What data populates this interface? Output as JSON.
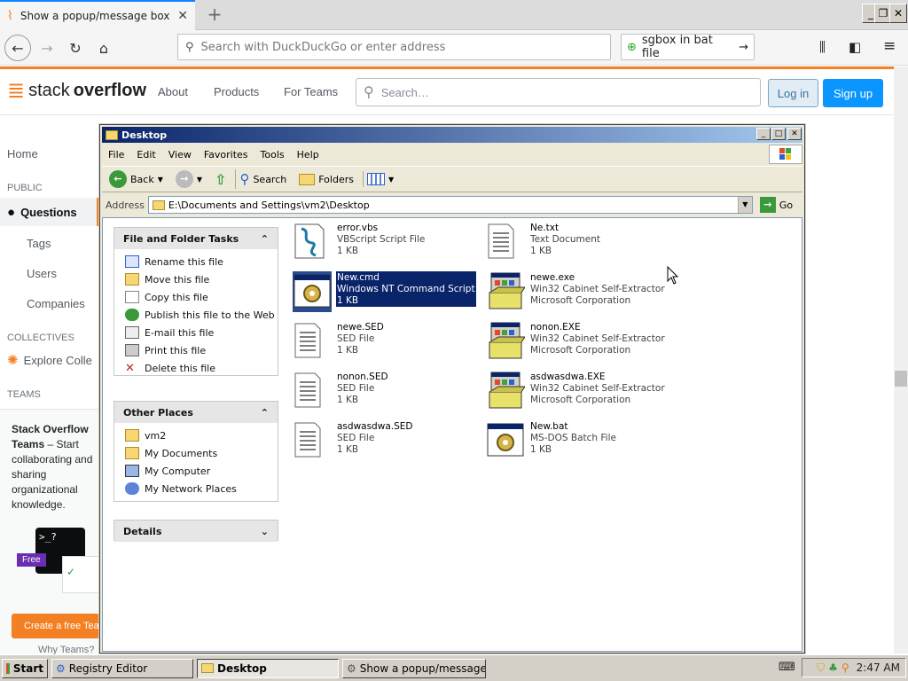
{
  "browser": {
    "tab_title": "Show a popup/message box from",
    "url_placeholder": "Search with DuckDuckGo or enter address",
    "search_value": "sgbox in bat file"
  },
  "stackoverflow": {
    "logo_pre": "stack",
    "logo_bold": "overflow",
    "nav": [
      "About",
      "Products",
      "For Teams"
    ],
    "search_placeholder": "Search…",
    "login": "Log in",
    "signup": "Sign up",
    "sidebar": {
      "home": "Home",
      "public": "PUBLIC",
      "questions": "Questions",
      "tags": "Tags",
      "users": "Users",
      "companies": "Companies",
      "collectives": "COLLECTIVES",
      "explore": "Explore Colle",
      "teams": "TEAMS",
      "teams_title": "Stack Overflow",
      "teams_title2": "Teams",
      "teams_desc": "– Start collaborating and sharing organizational knowledge.",
      "free": "Free",
      "create": "Create a free Tea",
      "why": "Why Teams?"
    }
  },
  "explorer": {
    "title": "Desktop",
    "menu": [
      "File",
      "Edit",
      "View",
      "Favorites",
      "Tools",
      "Help"
    ],
    "toolbar": {
      "back": "Back",
      "search": "Search",
      "folders": "Folders"
    },
    "address_label": "Address",
    "address": "E:\\Documents and Settings\\vm2\\Desktop",
    "go": "Go",
    "file_tasks": {
      "title": "File and Folder Tasks",
      "items": [
        "Rename this file",
        "Move this file",
        "Copy this file",
        "Publish this file to the Web",
        "E-mail this file",
        "Print this file",
        "Delete this file"
      ]
    },
    "other_places": {
      "title": "Other Places",
      "items": [
        "vm2",
        "My Documents",
        "My Computer",
        "My Network Places"
      ]
    },
    "details": {
      "title": "Details"
    },
    "files": [
      {
        "name": "error.vbs",
        "type": "VBScript Script File",
        "info": "1 KB",
        "icon": "vbscript-icon"
      },
      {
        "name": "Ne.txt",
        "type": "Text Document",
        "info": "1 KB",
        "icon": "text-file-icon"
      },
      {
        "name": "New.cmd",
        "type": "Windows NT Command Script",
        "info": "1 KB",
        "icon": "cmd-script-icon",
        "selected": true
      },
      {
        "name": "newe.exe",
        "type": "Win32 Cabinet Self-Extractor",
        "info": "Microsoft Corporation",
        "icon": "installer-icon"
      },
      {
        "name": "newe.SED",
        "type": "SED File",
        "info": "1 KB",
        "icon": "text-file-icon"
      },
      {
        "name": "nonon.EXE",
        "type": "Win32 Cabinet Self-Extractor",
        "info": "Microsoft Corporation",
        "icon": "installer-icon"
      },
      {
        "name": "nonon.SED",
        "type": "SED File",
        "info": "1 KB",
        "icon": "text-file-icon"
      },
      {
        "name": "asdwasdwa.EXE",
        "type": "Win32 Cabinet Self-Extractor",
        "info": "Microsoft Corporation",
        "icon": "installer-icon"
      },
      {
        "name": "asdwasdwa.SED",
        "type": "SED File",
        "info": "1 KB",
        "icon": "text-file-icon"
      },
      {
        "name": "New.bat",
        "type": "MS-DOS Batch File",
        "info": "1 KB",
        "icon": "batch-file-icon"
      }
    ]
  },
  "taskbar": {
    "start": "Start",
    "tasks": [
      "Registry Editor",
      "Desktop",
      "Show a popup/message ..."
    ],
    "time": "2:47 AM"
  }
}
